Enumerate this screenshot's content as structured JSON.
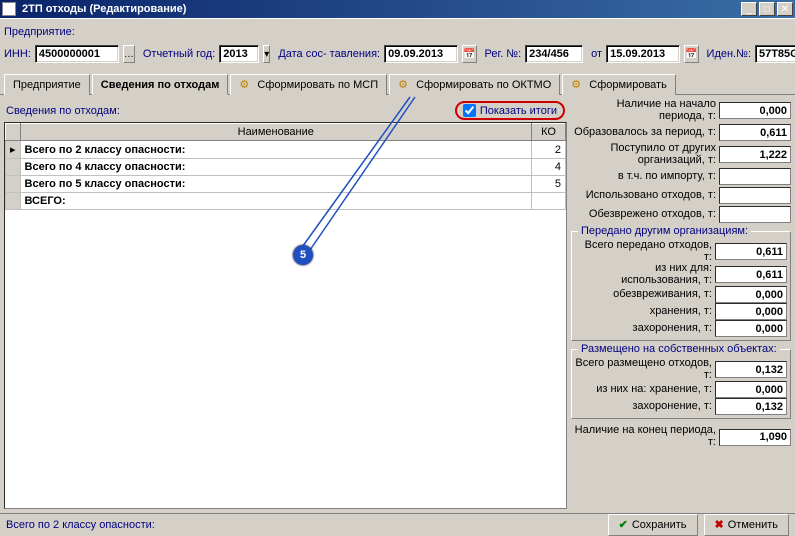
{
  "window": {
    "title": "2ТП отходы (Редактирование)"
  },
  "header": {
    "enterprise_label": "Предприятие:",
    "inn_label": "ИНН:",
    "inn": "4500000001",
    "year_label": "Отчетный год:",
    "year": "2013",
    "date_label": "Дата сос- тавления:",
    "date": "09.09.2013",
    "reg_label": "Рег. №:",
    "reg": "234/456",
    "ot_label": "от",
    "ot_date": "15.09.2013",
    "iden_label": "Иден.№:",
    "iden": "57T85GFH"
  },
  "tabs": {
    "t1": "Предприятие",
    "t2": "Сведения по отходам",
    "t3": "Сформировать по МСП",
    "t4": "Сформировать по ОКТМО",
    "t5": "Сформировать"
  },
  "grid": {
    "subheader": "Сведения по отходам:",
    "show_totals": "Показать итоги",
    "col_name": "Наименование",
    "col_ko": "КО",
    "rows": {
      "r1": {
        "name": "Всего по 2 классу опасности:",
        "ko": "2"
      },
      "r2": {
        "name": "Всего по 4 классу опасности:",
        "ko": "4"
      },
      "r3": {
        "name": "Всего по 5 классу опасности:",
        "ko": "5"
      },
      "r4": {
        "name": "ВСЕГО:",
        "ko": ""
      }
    }
  },
  "right": {
    "balance_start_l": "Наличие на начало периода, т:",
    "balance_start": "0,000",
    "formed_l": "Образовалось за период, т:",
    "formed": "0,611",
    "received_l": "Поступило от других организаций, т:",
    "received": "1,222",
    "import_l": "в т.ч. по импорту, т:",
    "used_l": "Использовано отходов, т:",
    "neutralized_l": "Обезврежено отходов, т:",
    "group1": "Передано другим организациям:",
    "g1_total_l": "Всего передано отходов, т:",
    "g1_total": "0,611",
    "g1_of_l": "из них для:    использования, т:",
    "g1_of": "0,611",
    "g1_neut_l": "обезвреживания, т:",
    "g1_neut": "0,000",
    "g1_store_l": "хранения, т:",
    "g1_store": "0,000",
    "g1_bury_l": "захоронения, т:",
    "g1_bury": "0,000",
    "group2": "Размещено на собственных объектах:",
    "g2_total_l": "Всего размещено отходов, т:",
    "g2_total": "0,132",
    "g2_of_l": "из них на:         хранение, т:",
    "g2_of": "0,000",
    "g2_bury_l": "захоронение, т:",
    "g2_bury": "0,132",
    "balance_end_l": "Наличие на конец периода, т:",
    "balance_end": "1,090"
  },
  "footer": {
    "status": "Всего по 2 классу опасности:",
    "save": "Сохранить",
    "cancel": "Отменить"
  },
  "callout": "5"
}
